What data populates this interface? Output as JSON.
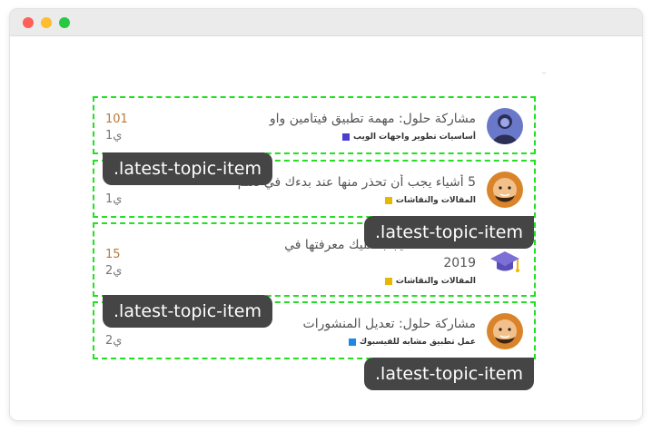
{
  "window": {
    "buttons": [
      "close",
      "minimize",
      "maximize"
    ]
  },
  "topics": [
    {
      "title": "مشاركة حلول: مهمة تطبيق فيتامين واو",
      "title_line2": "",
      "category": "أساسيات تطوير واجهات الويب",
      "category_color": "#4a3fd1",
      "count": "101",
      "age": "1ي",
      "avatar": "avatar-person-blue"
    },
    {
      "title": "5 أشياء يجب أن تحذر منها عند بدءك في تعلم",
      "title_line2": "",
      "category": "المقالات والنقاشات",
      "category_color": "#e6b800",
      "count": "",
      "age": "1ي",
      "avatar": "avatar-bald-man"
    },
    {
      "title": "framework يجب عليك معرفتها في",
      "title_line2": "2019",
      "category": "المقالات والنقاشات",
      "category_color": "#e6b800",
      "count": "15",
      "age": "2ي",
      "avatar": "graduation-cap-icon"
    },
    {
      "title": "مشاركة حلول: تعديل المنشورات",
      "title_line2": "",
      "category": "عمل تطبيق مشابه للفيسبوك",
      "category_color": "#1e88e5",
      "count": "",
      "age": "2ي",
      "avatar": "avatar-bald-man"
    }
  ],
  "labels": {
    "pill_1": ".latest-topic-item",
    "pill_2": ".latest-topic-item",
    "pill_3": ".latest-topic-item",
    "pill_4": ".latest-topic-item"
  }
}
